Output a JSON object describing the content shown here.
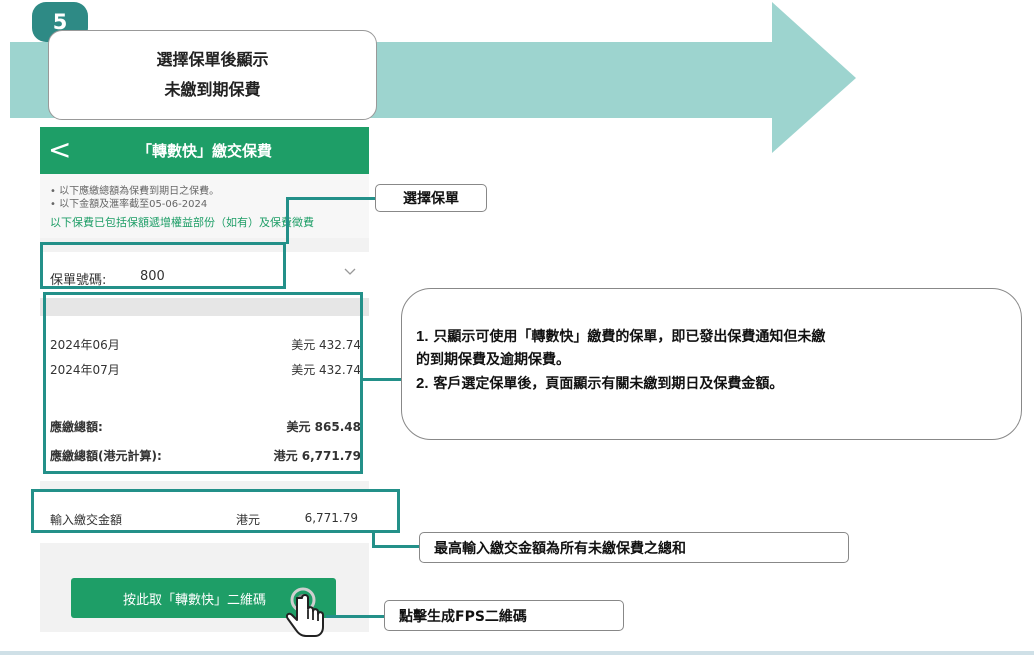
{
  "step": {
    "number": "5",
    "title_lines": [
      "選擇保單後顯示",
      "未繳到期保費"
    ]
  },
  "phone": {
    "title": "「轉數快」繳交保費",
    "back_glyph": "<",
    "notes": [
      "• 以下應繳總額為保費到期日之保費。",
      "• 以下金額及滙率截至05-06-2024"
    ],
    "note_green": "以下保費已包括保額遞增權益部份（如有）及保費徵費",
    "policy_label": "保單號碼:",
    "policy_value": "800",
    "items": [
      {
        "label": "2024年06月",
        "amount": "美元 432.74"
      },
      {
        "label": "2024年07月",
        "amount": "美元 432.74"
      }
    ],
    "total_label": "應繳總額:",
    "total_value": "美元 865.48",
    "total_hkd_label": "應繳總額(港元計算):",
    "total_hkd_value": "港元 6,771.79",
    "input_label": "輸入繳交金額",
    "input_currency": "港元",
    "input_value": "6,771.79",
    "button_label": "按此取「轉數快」二維碼"
  },
  "callouts": {
    "select_policy": "選擇保單",
    "bubble_line1_num": "1.",
    "bubble_line1": " 只顯示可使用「轉數快」繳費的保單，即已發出保費通知但未繳",
    "bubble_line2": "的到期保費及逾期保費。",
    "bubble_line3_num": "2.",
    "bubble_line3": " 客戶選定保單後，頁面顯示有關未繳到期日及保費金額。",
    "max_input": "最高輸入繳交金額為所有未繳保費之總和",
    "generate_qr": "點擊生成FPS二維碼"
  },
  "colors": {
    "arrow": "#9dd4cf",
    "badge": "#2e8a85",
    "app_green": "#1e9e67",
    "highlight": "#239089"
  },
  "icons": {
    "hand": "hand-pointer-icon",
    "chevron": "chevron-down-icon",
    "back": "back-arrow-icon"
  }
}
